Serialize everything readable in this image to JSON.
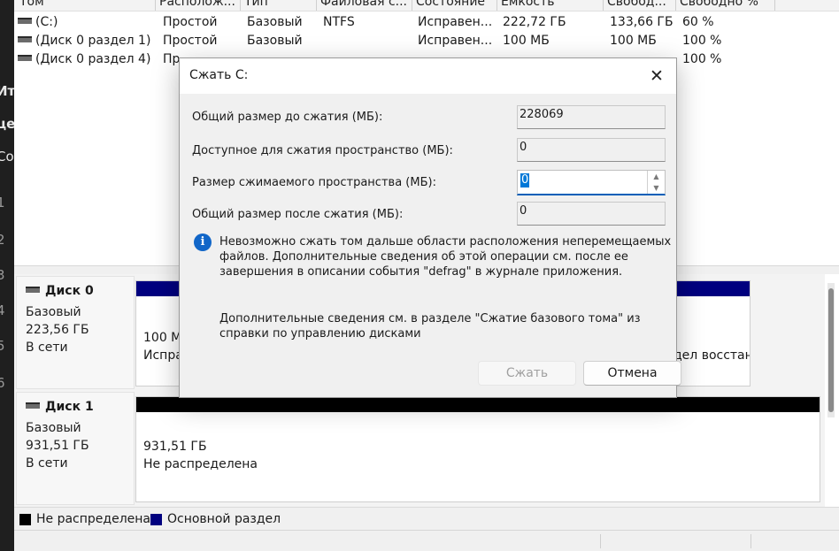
{
  "left_strip": {
    "fragments": [
      "Ит",
      "це",
      "Со",
      "1",
      "2",
      "3",
      "4",
      "5",
      "6"
    ]
  },
  "volume_table": {
    "columns": [
      "Том",
      "Располож...",
      "Тип",
      "Файловая с...",
      "Состояние",
      "Емкость",
      "Свобод...",
      "Свободно %"
    ],
    "rows": [
      [
        "(C:)",
        "Простой",
        "Базовый",
        "NTFS",
        "Исправен...",
        "222,72 ГБ",
        "133,66 ГБ",
        "60 %"
      ],
      [
        "(Диск 0 раздел 1)",
        "Простой",
        "Базовый",
        "",
        "Исправен...",
        "100 МБ",
        "100 МБ",
        "100 %"
      ],
      [
        "(Диск 0 раздел 4)",
        "Пр",
        "",
        "",
        "",
        "",
        "",
        "100 %"
      ]
    ]
  },
  "disks": [
    {
      "name": "Диск 0",
      "type": "Базовый",
      "size": "223,56 ГБ",
      "status": "В сети",
      "part_left": [
        "100 М",
        "Испра"
      ],
      "part_right": [
        "дел восстан"
      ]
    },
    {
      "name": "Диск 1",
      "type": "Базовый",
      "size": "931,51 ГБ",
      "status": "В сети",
      "part": [
        "931,51 ГБ",
        "Не распределена"
      ]
    }
  ],
  "legend": {
    "unallocated": "Не распределена",
    "primary": "Основной раздел"
  },
  "colors": {
    "unallocated": "#000000",
    "primary": "#00007f",
    "accent": "#0078d7",
    "info_icon": "#1166c8"
  },
  "dialog": {
    "title": "Сжать C:",
    "close_icon": "close-icon",
    "fields": {
      "total_before_label": "Общий размер до сжатия (МБ):",
      "total_before_value": "228069",
      "available_label": "Доступное для сжатия пространство (МБ):",
      "available_value": "0",
      "shrink_label": "Размер сжимаемого пространства (МБ):",
      "shrink_value": "0",
      "total_after_label": "Общий размер после сжатия (МБ):",
      "total_after_value": "0"
    },
    "info_lines": [
      "Невозможно сжать том дальше области расположения неперемещаемых",
      "файлов. Дополнительные сведения об этой операции см. после ее",
      "завершения в описании события \"defrag\" в журнале приложения."
    ],
    "help_lines": [
      "Дополнительные сведения см. в разделе \"Сжатие базового тома\" из",
      "справки по управлению дисками"
    ],
    "shrink_button": "Сжать",
    "cancel_button": "Отмена"
  }
}
